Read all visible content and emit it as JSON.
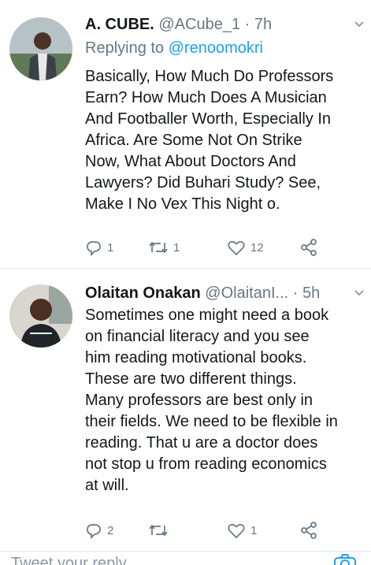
{
  "tweets": [
    {
      "name": "A. CUBE.",
      "handle": "@ACube_1",
      "separator": "·",
      "time": "7h",
      "replying_prefix": "Replying to",
      "replying_to": "@renoomokri",
      "lines": [
        "Basically, How Much Do Professors",
        "Earn? How Much Does A Musician",
        "And Footballer Worth, Especially In",
        "Africa. Are Some Not On Strike",
        "Now, What About Doctors And",
        "Lawyers? Did Buhari Study? See,",
        "Make I No Vex This Night o."
      ],
      "replies": "1",
      "retweets": "1",
      "likes": "12"
    },
    {
      "name": "Olaitan Onakan",
      "handle": "@OlaitanI...",
      "separator": "·",
      "time": "5h",
      "lines": [
        "Sometimes one might need a book",
        "on financial literacy and you see",
        "him reading motivational books.",
        "These are two different things.",
        "Many professors are best only in",
        "their fields. We need to be flexible in",
        "reading. That u are a doctor does",
        "not stop u from reading economics",
        "at will."
      ],
      "replies": "2",
      "retweets": "",
      "likes": "1"
    }
  ],
  "composer": {
    "placeholder": "Tweet your reply"
  },
  "colors": {
    "accent": "#1da1f2",
    "muted": "#657786",
    "text": "#14171a",
    "divider": "#e1e8ed"
  },
  "icons": [
    "reply-icon",
    "retweet-icon",
    "like-icon",
    "share-icon",
    "chevron-down-icon",
    "camera-icon"
  ]
}
